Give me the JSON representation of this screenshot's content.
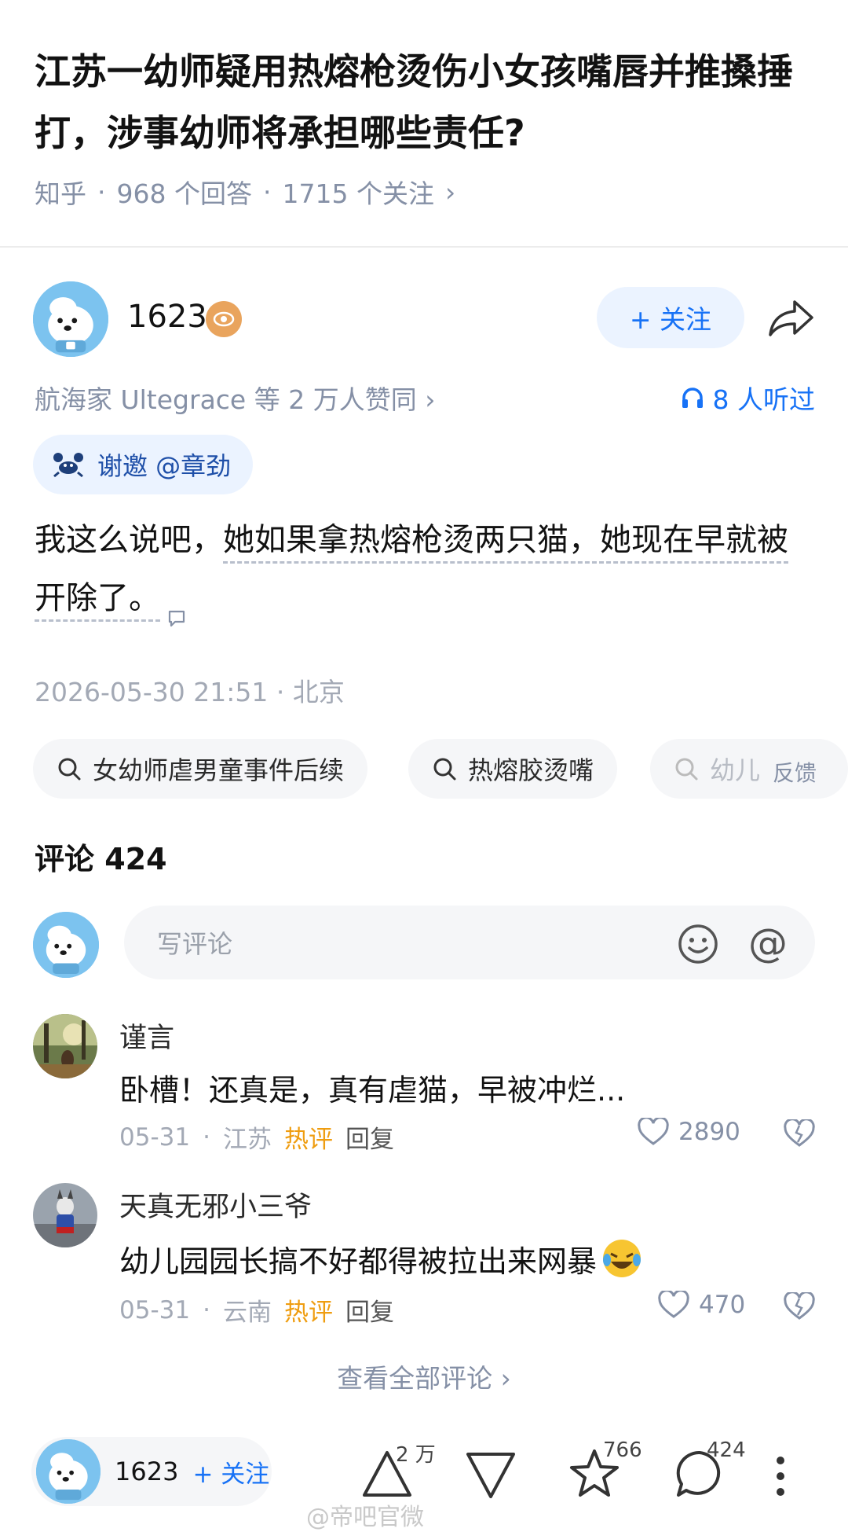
{
  "question": {
    "title": "江苏一幼师疑用热熔枪烫伤小女孩嘴唇并推搡捶打，涉事幼师将承担哪些责任?",
    "source": "知乎",
    "answers": "968 个回答",
    "followers": "1715 个关注",
    "sep": "·",
    "chevron": "›"
  },
  "author": {
    "name": "1623",
    "badge_icon": "eye-badge-icon",
    "follow_label": "+ 关注",
    "agree_text": "航海家 Ultegrace 等 2 万人赞同 ›",
    "listen_text": "8 人听过",
    "invite_text": "谢邀 @章劲"
  },
  "answer": {
    "lead": "我这么说吧，",
    "highlight": "她如果拿热熔枪烫两只猫，她现在早就被开除了。",
    "timestamp": "2026-05-30 21:51 · 北京"
  },
  "search_chips": [
    {
      "label": "女幼师虐男童事件后续"
    },
    {
      "label": "热熔胶烫嘴"
    },
    {
      "label": "幼儿"
    }
  ],
  "feedback_label": "反馈",
  "comments": {
    "title": "评论 424",
    "input_placeholder": "写评论",
    "at_symbol": "@",
    "items": [
      {
        "name": "谨言",
        "text": "卧槽！还真是，真有虐猫，早被冲烂...",
        "date": "05-31",
        "location": "江苏",
        "hot": "热评",
        "reply": "回复",
        "likes": "2890"
      },
      {
        "name": "天真无邪小三爷",
        "text": "幼儿园园长搞不好都得被拉出来网暴",
        "date": "05-31",
        "location": "云南",
        "hot": "热评",
        "reply": "回复",
        "likes": "470"
      }
    ],
    "view_all": "查看全部评论 ›"
  },
  "bottom_bar": {
    "name": "1623",
    "follow_label": "+ 关注",
    "upvotes": "2 万",
    "favorites": "766",
    "comments": "424"
  },
  "watermark": "@帝吧官微",
  "colors": {
    "accent": "#1772f6",
    "hot": "#ef9d10",
    "muted": "#8590a6"
  }
}
